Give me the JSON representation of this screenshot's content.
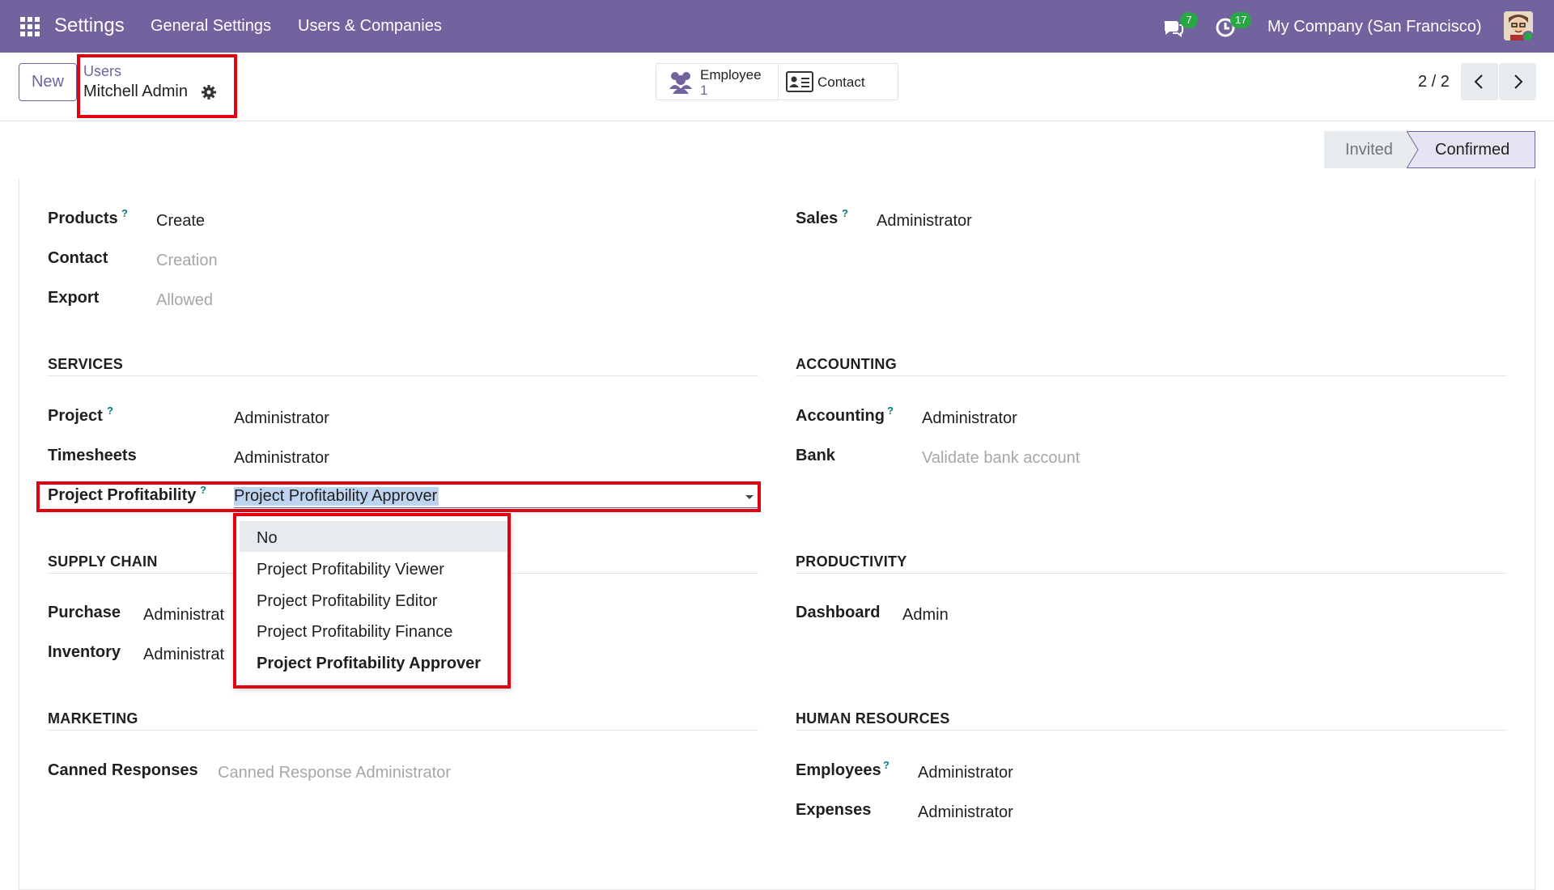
{
  "navbar": {
    "brand": "Settings",
    "menu": [
      "General Settings",
      "Users & Companies"
    ],
    "messages_badge": "7",
    "activities_badge": "17",
    "company": "My Company (San Francisco)"
  },
  "control_panel": {
    "new_label": "New",
    "breadcrumb_parent": "Users",
    "breadcrumb_current": "Mitchell Admin",
    "stat_employee_label": "Employee",
    "stat_employee_count": "1",
    "stat_contact_label": "Contact",
    "pager": "2 / 2"
  },
  "status": {
    "invited": "Invited",
    "confirmed": "Confirmed"
  },
  "top_fields": {
    "products_label": "Products",
    "products_value": "Create",
    "contact_label": "Contact",
    "contact_value": "Creation",
    "export_label": "Export",
    "export_value": "Allowed",
    "sales_label": "Sales",
    "sales_value": "Administrator"
  },
  "services": {
    "title": "SERVICES",
    "project_label": "Project",
    "project_value": "Administrator",
    "timesheets_label": "Timesheets",
    "timesheets_value": "Administrator",
    "pp_label": "Project Profitability",
    "pp_value": "Project Profitability Approver"
  },
  "accounting": {
    "title": "ACCOUNTING",
    "accounting_label": "Accounting",
    "accounting_value": "Administrator",
    "bank_label": "Bank",
    "bank_value": "Validate bank account"
  },
  "supply_chain": {
    "title": "SUPPLY CHAIN",
    "purchase_label": "Purchase",
    "purchase_value": "Administrat",
    "inventory_label": "Inventory",
    "inventory_value": "Administrat"
  },
  "productivity": {
    "title": "PRODUCTIVITY",
    "dashboard_label": "Dashboard",
    "dashboard_value": "Admin"
  },
  "marketing": {
    "title": "MARKETING",
    "canned_label": "Canned Responses",
    "canned_value": "Canned Response Administrator"
  },
  "human_resources": {
    "title": "HUMAN RESOURCES",
    "employees_label": "Employees",
    "employees_value": "Administrator",
    "expenses_label": "Expenses",
    "expenses_value": "Administrator"
  },
  "dropdown": {
    "options": [
      "No",
      "Project Profitability Viewer",
      "Project Profitability Editor",
      "Project Profitability Finance",
      "Project Profitability Approver"
    ]
  },
  "help_mark": "?",
  "colors": {
    "navbar": "#71639e",
    "badge": "#28a745",
    "highlight_border": "#e3000f",
    "help": "#017e84"
  }
}
